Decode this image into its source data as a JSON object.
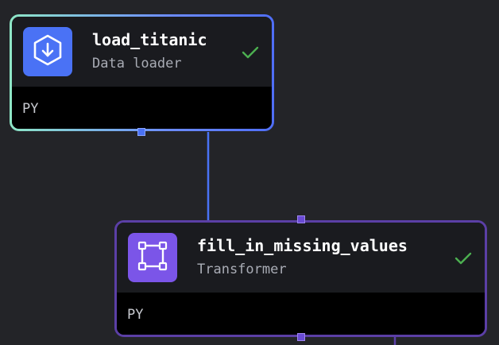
{
  "colors": {
    "canvas_background": "#232428",
    "loader_accent": "#4a72f5",
    "transformer_accent": "#7b55e8",
    "transformer_border": "#5b3fa6",
    "edge_blue": "#4a72f5",
    "edge_purple": "#5b3fa6",
    "status_success": "#4caf50"
  },
  "nodes": [
    {
      "title": "load_titanic",
      "type_label": "Data loader",
      "language": "PY",
      "icon": "download-icon",
      "status": "success"
    },
    {
      "title": "fill_in_missing_values",
      "type_label": "Transformer",
      "language": "PY",
      "icon": "transform-frame-icon",
      "status": "success"
    }
  ]
}
